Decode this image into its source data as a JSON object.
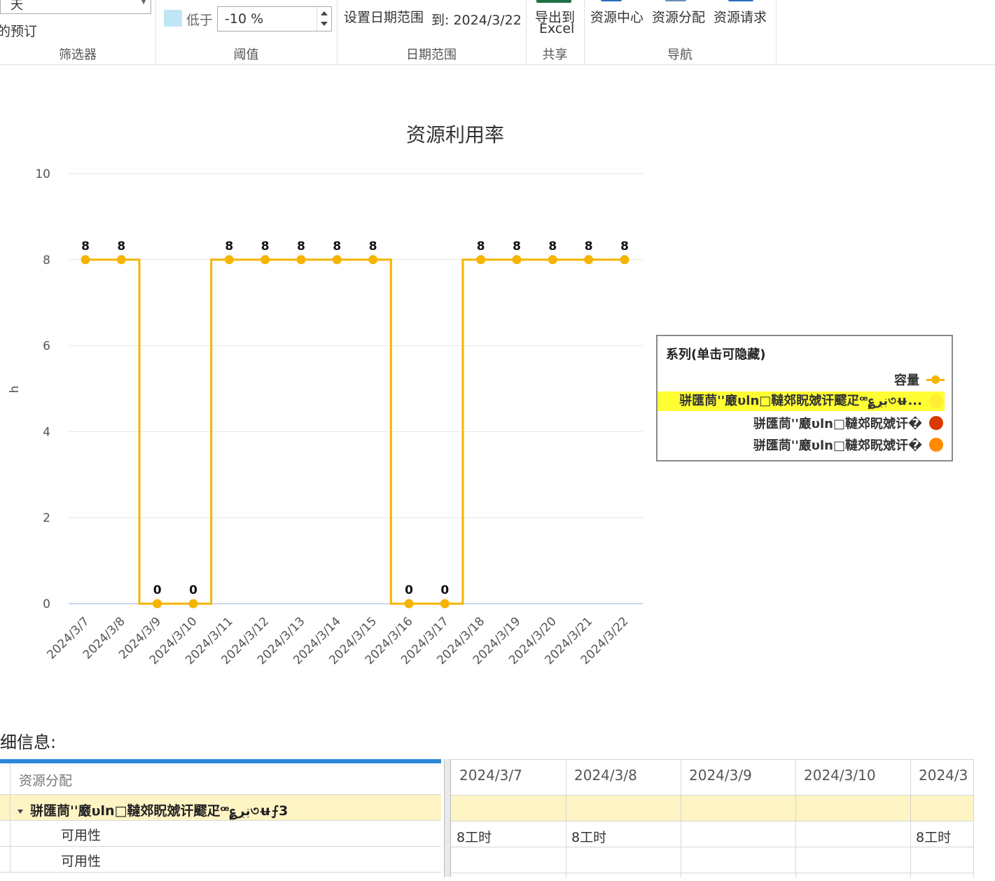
{
  "ribbon": {
    "filter": {
      "select_value": "天",
      "checkbox_label": "的预订",
      "group_label": "筛选器"
    },
    "threshold": {
      "label": "低于",
      "value": "-10 %",
      "group_label": "阈值"
    },
    "date_range": {
      "set_label": "设置日期范围",
      "to_label": "到: 2024/3/22",
      "group_label": "日期范围"
    },
    "share": {
      "export_label_1": "导出到",
      "export_label_2": "Excel",
      "group_label": "共享"
    },
    "nav": {
      "resource_center": "资源中心",
      "resource_assignment": "资源分配",
      "resource_request": "资源请求",
      "group_label": "导航"
    }
  },
  "chart_data": {
    "type": "line",
    "title": "资源利用率",
    "ylabel": "h",
    "ylim": [
      0,
      10
    ],
    "yticks": [
      "0",
      "2",
      "4",
      "6",
      "8",
      "10"
    ],
    "line_shape": "step",
    "categories": [
      "2024/3/7",
      "2024/3/8",
      "2024/3/9",
      "2024/3/10",
      "2024/3/11",
      "2024/3/12",
      "2024/3/13",
      "2024/3/14",
      "2024/3/15",
      "2024/3/16",
      "2024/3/17",
      "2024/3/18",
      "2024/3/19",
      "2024/3/20",
      "2024/3/21",
      "2024/3/22"
    ],
    "series": [
      {
        "name": "容量",
        "color": "#f5b400",
        "values": [
          8,
          8,
          0,
          0,
          8,
          8,
          8,
          8,
          8,
          0,
          0,
          8,
          8,
          8,
          8,
          8
        ]
      }
    ],
    "legend": {
      "title": "系列(单击可隐藏)",
      "position": "right",
      "items": [
        {
          "name": "容量",
          "color": "#f5b400",
          "marker": "line"
        },
        {
          "name": "骈匯茼ꞌꞌ黀υln□韃郊眖虠讦飂疋ꟹ؏ڹڔ৩ʉ...",
          "color": "#ffee33",
          "marker": "dot",
          "highlighted": true
        },
        {
          "name": "骈匯茼ꞌꞌ黀υln□韃郊眖虠讦�",
          "color": "#d83b01",
          "marker": "dot"
        },
        {
          "name": "骈匯茼ꞌꞌ黀υln□韃郊眖虠讦�",
          "color": "#ff8c00",
          "marker": "dot"
        }
      ]
    }
  },
  "details": {
    "title": "细信息:",
    "left_header": "资源分配",
    "group_row": "骈匯茼ꞌꞌ黀υln□韃郊眖虠讦飂疋ꟹ؏ڹڔ৩ʉ⨍3",
    "rows": [
      "可用性",
      "可用性"
    ],
    "date_columns": [
      "2024/3/7",
      "2024/3/8",
      "2024/3/9",
      "2024/3/10",
      "2024/3"
    ],
    "availability_cells": [
      "8工时",
      "8工时",
      "",
      "",
      "8工时"
    ]
  }
}
